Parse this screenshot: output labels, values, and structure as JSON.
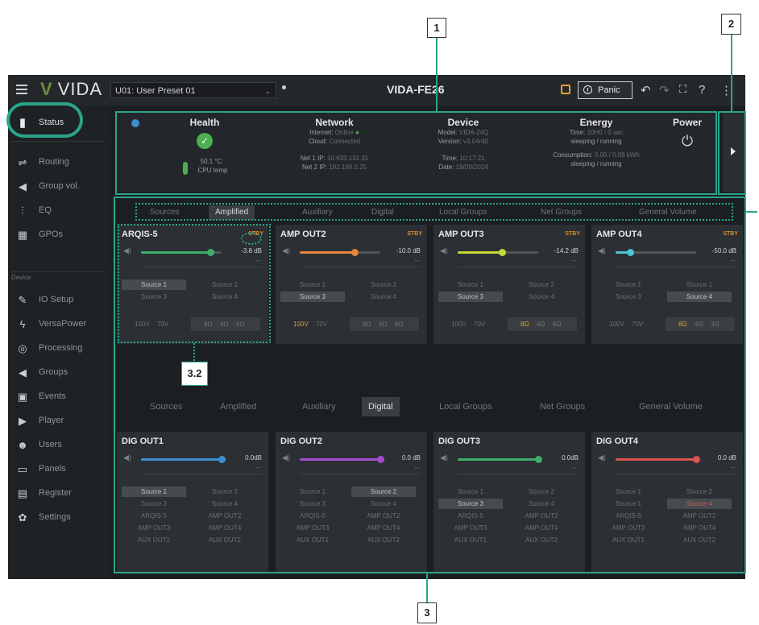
{
  "topbar": {
    "logo": "VIDA",
    "preset": "U01: User Preset 01",
    "device_title": "VIDA-FE26",
    "panic_label": "Panic"
  },
  "sidebar": {
    "items": [
      {
        "label": "Status",
        "icon": "bar-chart-icon"
      },
      {
        "label": "Routing",
        "icon": "routing-icon"
      },
      {
        "label": "Group vol.",
        "icon": "speaker-icon"
      },
      {
        "label": "EQ",
        "icon": "eq-icon"
      },
      {
        "label": "GPOs",
        "icon": "gpo-icon"
      },
      {
        "label": "IO Setup",
        "icon": "wrench-icon"
      },
      {
        "label": "VersaPower",
        "icon": "bolt-icon"
      },
      {
        "label": "Processing",
        "icon": "processing-icon"
      },
      {
        "label": "Groups",
        "icon": "speaker-icon"
      },
      {
        "label": "Events",
        "icon": "calendar-icon"
      },
      {
        "label": "Player",
        "icon": "play-icon"
      },
      {
        "label": "Users",
        "icon": "users-icon"
      },
      {
        "label": "Panels",
        "icon": "panels-icon"
      },
      {
        "label": "Register",
        "icon": "document-icon"
      },
      {
        "label": "Settings",
        "icon": "gear-icon"
      }
    ],
    "section_device": "Device"
  },
  "status": {
    "health": {
      "title": "Health",
      "temp": "50.1 °C",
      "temp_label": "CPU temp"
    },
    "network": {
      "title": "Network",
      "internet_label": "Internet:",
      "internet_value": "Online",
      "cloud_label": "Cloud:",
      "cloud_value": "Connected",
      "net1_label": "Net 1 IP:",
      "net1_value": "10.633.131.31",
      "net2_label": "Net 2 IP:",
      "net2_value": "192.168.0.25"
    },
    "device": {
      "title": "Device",
      "model_label": "Model:",
      "model_value": "VIDA-24Q",
      "version_label": "Version:",
      "version_value": "v3.04r40",
      "time_label": "Time:",
      "time_value": "10:17:21",
      "date_label": "Date:",
      "date_value": "19/09/2024"
    },
    "energy": {
      "title": "Energy",
      "time_label": "Time:",
      "time_value": "10H0 / 0 sec",
      "time_sub": "sleeping / running",
      "consumption_label": "Consumption:",
      "consumption_value": "0.00 / 0.08 kWh",
      "consumption_sub": "sleeping / running"
    },
    "power": {
      "title": "Power"
    }
  },
  "tabs_top": [
    "Sources",
    "Amplified",
    "Auxiliary",
    "Digital",
    "Local Groups",
    "Net Groups",
    "General Volume"
  ],
  "tabs_bottom": [
    "Sources",
    "Amplified",
    "Auxiliary",
    "Digital",
    "Local Groups",
    "Net Groups",
    "General Volume"
  ],
  "amp_cards": [
    {
      "title": "ARQIS-5",
      "stby": "STBY",
      "db": "-3.8 dB",
      "level": 0.86,
      "color": "#3fae6a",
      "dash": "--",
      "sources": [
        "Source 1",
        "Source 2",
        "Source 3",
        "Source 4"
      ],
      "selected": 0,
      "volt": [
        "100V",
        "70V"
      ],
      "volt_on": -1,
      "imp": [
        "8Ω",
        "4Ω",
        "6Ω"
      ],
      "imp_on": -1
    },
    {
      "title": "AMP OUT2",
      "stby": "STBY",
      "db": "-10.0 dB",
      "level": 0.68,
      "color": "#e8853a",
      "dash": "--",
      "sources": [
        "Source 1",
        "Source 2",
        "Source 3",
        "Source 4"
      ],
      "selected": 2,
      "volt": [
        "100V",
        "70V"
      ],
      "volt_on": 0,
      "imp": [
        "8Ω",
        "4Ω",
        "8Ω"
      ],
      "imp_on": -1
    },
    {
      "title": "AMP OUT3",
      "stby": "STBY",
      "db": "-14.2 dB",
      "level": 0.55,
      "color": "#c7d83a",
      "dash": "--",
      "sources": [
        "Source 1",
        "Source 2",
        "Source 3",
        "Source 4"
      ],
      "selected": 2,
      "volt": [
        "100V",
        "70V"
      ],
      "volt_on": -1,
      "imp": [
        "8Ω",
        "4Ω",
        "6Ω"
      ],
      "imp_on": 0
    },
    {
      "title": "AMP OUT4",
      "stby": "STBY",
      "db": "-50.0 dB",
      "level": 0.18,
      "color": "#4bc4d8",
      "dash": "--",
      "sources": [
        "Source 1",
        "Source 1",
        "Source 3",
        "Source 4"
      ],
      "selected": 3,
      "volt": [
        "100V",
        "70V"
      ],
      "volt_on": -1,
      "imp": [
        "8Ω",
        "4Ω",
        "3Ω"
      ],
      "imp_on": 0
    }
  ],
  "dig_cards": [
    {
      "title": "DIG OUT1",
      "db": "0.0dB",
      "level": 1.0,
      "color": "#3d8fd0",
      "dash": "--",
      "sources": [
        "Source 1",
        "Source 2",
        "Source 3",
        "Source 4",
        "ARQIS-5",
        "AMP OUT2",
        "AMP OUT3",
        "AMP OUT4",
        "AUX OUT1",
        "AUX OUT2"
      ],
      "selected": 0
    },
    {
      "title": "DIG OUT2",
      "db": "0.0 dB",
      "level": 1.0,
      "color": "#a64cd0",
      "dash": "--",
      "sources": [
        "Source 1",
        "Source 2",
        "Source 3",
        "Source 4",
        "ARQIS-5",
        "AMP OUT2",
        "AMP OUT3",
        "AMP OUT4",
        "AUX OUT1",
        "AUX OUT2"
      ],
      "selected": 1
    },
    {
      "title": "DIG OUT3",
      "db": "0.0dB",
      "level": 1.0,
      "color": "#3fae6a",
      "dash": "--",
      "sources": [
        "Source 1",
        "Source 2",
        "Source 3",
        "Source 4",
        "ARQIS-5",
        "AMP OUT2",
        "AMP OUT3",
        "AMP OUT4",
        "AUX OUT1",
        "AUX OUT2"
      ],
      "selected": 2
    },
    {
      "title": "DIG OUT4",
      "db": "0.0 dB",
      "level": 1.0,
      "color": "#d9534f",
      "dash": "--",
      "sources": [
        "Source 1",
        "Source 2",
        "Source 1",
        "Source 4",
        "ARQIS-5",
        "AMP OUT2",
        "AMP OUT3",
        "AMP OUT4",
        "AUX OUT1",
        "AUX OUT2"
      ],
      "selected": 3,
      "selected_red": true
    }
  ],
  "annotations": {
    "n1": "1",
    "n2": "2",
    "n3": "3",
    "n32": "3.2"
  }
}
